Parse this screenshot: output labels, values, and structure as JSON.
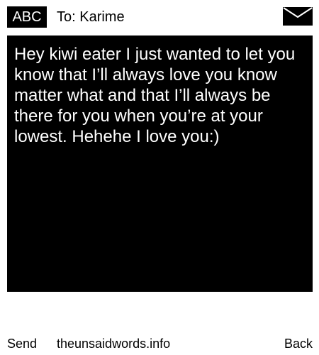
{
  "header": {
    "badge_label": "ABC",
    "recipient_label": "To: Karime",
    "envelope_icon": "envelope-icon"
  },
  "message": {
    "body": "Hey kiwi eater I just wanted to let you know that I’ll always love you know matter what and that I’ll always be there for you when you’re at your lowest. Hehehe I love you:)"
  },
  "footer": {
    "send_label": "Send",
    "site_label": "theunsaidwords.info",
    "back_label": "Back"
  },
  "colors": {
    "background": "#ffffff",
    "message_background": "#000000",
    "message_text": "#ffffff",
    "text": "#000000"
  }
}
